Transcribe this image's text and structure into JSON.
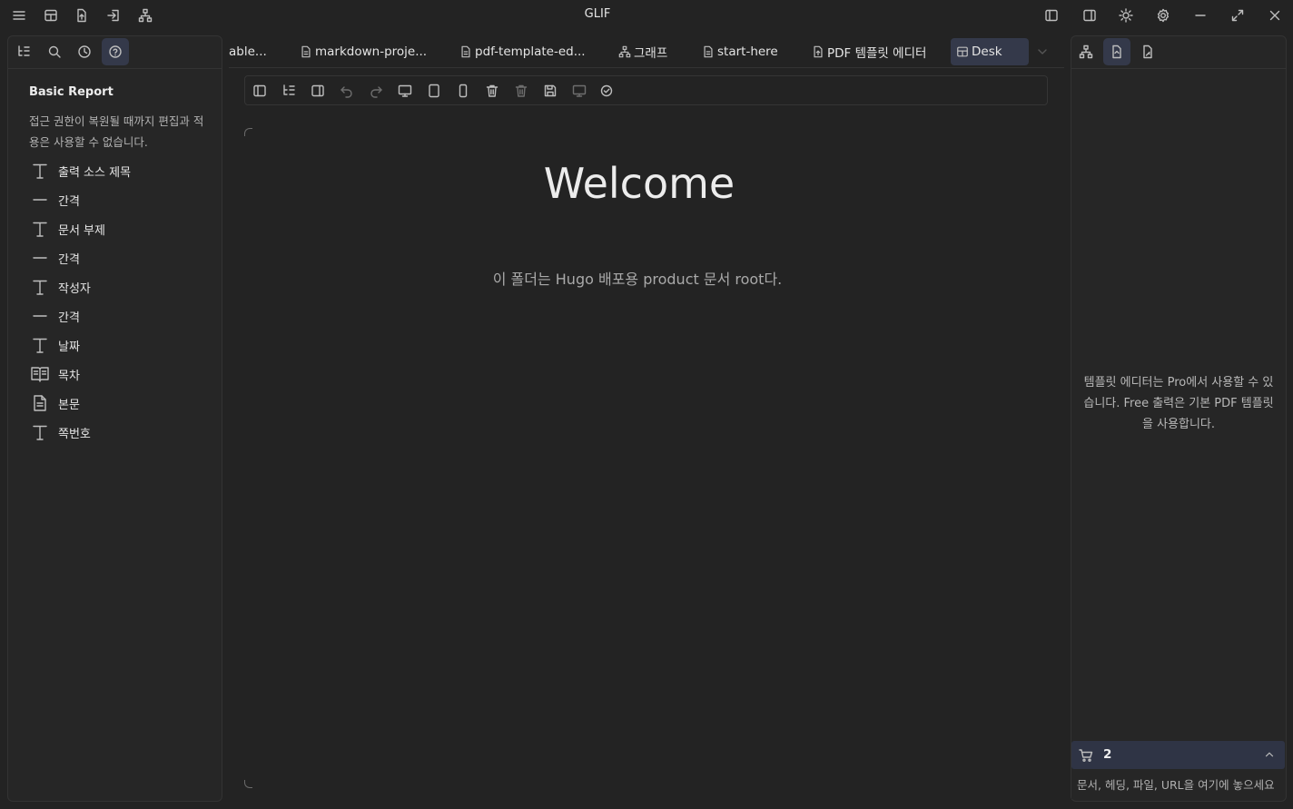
{
  "window": {
    "title": "GLIF"
  },
  "titlebar": {
    "left_icons": [
      "menu-icon",
      "layout-icon",
      "file-upload-icon",
      "sign-in-icon",
      "sitemap-icon"
    ],
    "right_icons": [
      "left-panel-toggle-icon",
      "right-panel-toggle-icon",
      "sun-icon",
      "settings-icon",
      "minimize-icon",
      "fullscreen-icon",
      "close-icon"
    ]
  },
  "left_panel": {
    "tabs": [
      "outline-icon",
      "search-icon",
      "history-icon",
      "help-icon"
    ],
    "active_tab": "help-icon",
    "title": "Basic Report",
    "notice": "접근 권한이 복원될 때까지 편집과 적용은 사용할 수 없습니다.",
    "blocks": [
      {
        "icon": "text-icon",
        "label": "출력 소스 제목"
      },
      {
        "icon": "divider-icon",
        "label": "간격"
      },
      {
        "icon": "text-icon",
        "label": "문서 부제"
      },
      {
        "icon": "divider-icon",
        "label": "간격"
      },
      {
        "icon": "text-icon",
        "label": "작성자"
      },
      {
        "icon": "divider-icon",
        "label": "간격"
      },
      {
        "icon": "text-icon",
        "label": "날짜"
      },
      {
        "icon": "book-icon",
        "label": "목차"
      },
      {
        "icon": "document-icon",
        "label": "본문"
      },
      {
        "icon": "text-icon",
        "label": "쪽번호"
      }
    ]
  },
  "tabs": [
    {
      "label": "able...",
      "icon": ""
    },
    {
      "label": "markdown-proje...",
      "icon": "file-icon"
    },
    {
      "label": "pdf-template-ed...",
      "icon": "file-icon"
    },
    {
      "label": "그래프",
      "icon": "graph-icon"
    },
    {
      "label": "start-here",
      "icon": "file-icon"
    },
    {
      "label": "PDF 템플릿 에디터",
      "icon": "pdf-file-icon"
    },
    {
      "label": "Desk",
      "icon": "desk-icon",
      "active": true
    }
  ],
  "toolbar": {
    "tools": [
      "toggle-left-panel-icon",
      "outline-tree-icon",
      "toggle-right-panel-icon",
      "undo-icon",
      "redo-icon",
      "desktop-preview-icon",
      "tablet-preview-icon",
      "mobile-preview-icon",
      "delete-icon",
      "delete-disabled-icon",
      "save-icon",
      "monitor-icon",
      "check-circle-icon"
    ]
  },
  "canvas": {
    "heading": "Welcome",
    "subtitle": "이 폴더는 Hugo 배포용 product 문서 root다."
  },
  "right_panel": {
    "tabs": [
      "sitemap-icon",
      "template-icon",
      "template-edit-icon"
    ],
    "active_tab": "template-icon",
    "notice": "템플릿 에디터는 Pro에서 사용할 수 있습니다. Free 출력은 기본 PDF 템플릿을 사용합니다.",
    "cart": {
      "count": "2"
    },
    "drop_placeholder": "문서, 헤딩, 파일, URL을 여기에 놓으세요"
  },
  "colors": {
    "background": "#232323",
    "panel": "#262626",
    "active_tab": "#34394a",
    "accent_bar": "#2f3445"
  }
}
